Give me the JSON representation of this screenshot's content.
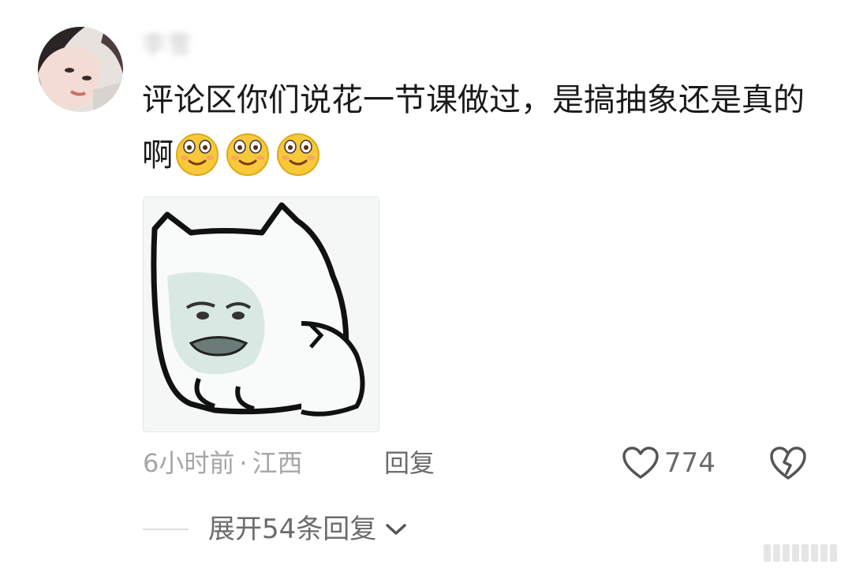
{
  "comment": {
    "username": "李雪",
    "text": "评论区你们说花一节课做过，是搞抽象还是真的啊",
    "emojis": [
      "smile-emoji",
      "smile-emoji",
      "smile-emoji"
    ],
    "sticker": "cat-meme-sticker"
  },
  "meta": {
    "time": "6小时前",
    "separator": "·",
    "location": "江西",
    "reply_label": "回复",
    "like_count": "774"
  },
  "replies": {
    "expand_label": "展开54条回复"
  },
  "colors": {
    "text_primary": "#1a1a1a",
    "text_meta": "#a6a6a6",
    "text_action": "#6b6b6b",
    "background": "#ffffff"
  }
}
